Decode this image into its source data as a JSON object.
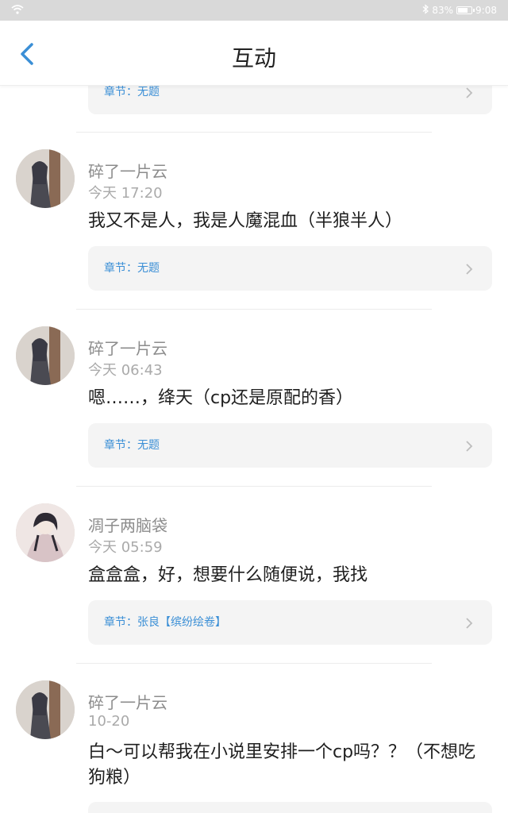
{
  "status_bar": {
    "battery_percent": "83%",
    "time": "9:08",
    "battery_level": 0.83
  },
  "header": {
    "title": "互动"
  },
  "comments": [
    {
      "chapter": "章节：无题"
    },
    {
      "user": "碎了一片云",
      "time": "今天 17:20",
      "text": "我又不是人，我是人魔混血（半狼半人）",
      "chapter": "章节：无题"
    },
    {
      "user": "碎了一片云",
      "time": "今天 06:43",
      "text": "嗯……，绛天（cp还是原配的香）",
      "chapter": "章节：无题"
    },
    {
      "user": "凋子两脑袋",
      "time": "今天 05:59",
      "text": "盒盒盒，好，想要什么随便说，我找",
      "chapter": "章节：张良【缤纷绘卷】"
    },
    {
      "user": "碎了一片云",
      "time": "10-20",
      "text": "白～可以帮我在小说里安排一个cp吗？？（不想吃狗粮）",
      "chapter": ""
    }
  ],
  "colors": {
    "accent": "#3b8fd6",
    "status_bar": "#d9d9d9",
    "card_bg": "#f4f4f4"
  },
  "icons": {
    "back": "chevron-left-icon",
    "card_arrow": "chevron-right-icon",
    "wifi": "wifi-icon",
    "bluetooth": "bluetooth-icon",
    "battery": "battery-icon"
  }
}
